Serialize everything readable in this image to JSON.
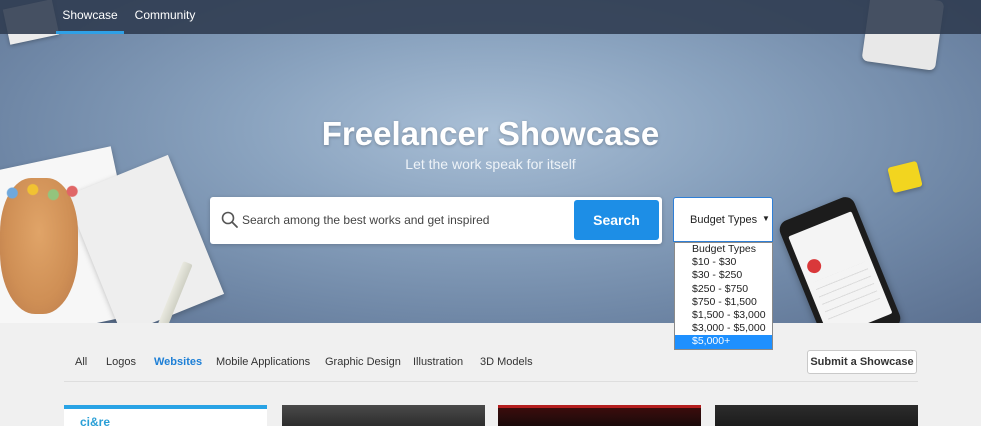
{
  "nav": {
    "items": [
      {
        "label": "Showcase",
        "active": true
      },
      {
        "label": "Community",
        "active": false
      }
    ]
  },
  "hero": {
    "title": "Freelancer Showcase",
    "subtitle": "Let the work speak for itself"
  },
  "search": {
    "placeholder": "Search among the best works and get inspired",
    "button_label": "Search"
  },
  "budget": {
    "selected": "Budget Types",
    "options": [
      "Budget Types",
      "$10 - $30",
      "$30 - $250",
      "$250 - $750",
      "$750 - $1,500",
      "$1,500 - $3,000",
      "$3,000 - $5,000",
      "$5,000+"
    ],
    "highlighted": "$5,000+"
  },
  "categories": {
    "tabs": [
      "All",
      "Logos",
      "Websites",
      "Mobile Applications",
      "Graphic Design",
      "Illustration",
      "3D Models"
    ],
    "active": "Websites",
    "submit_label": "Submit a Showcase"
  },
  "thumbnails": {
    "first_logo": "ci&re"
  },
  "colors": {
    "accent": "#1d8ee6",
    "nav_bg": "#2d3a4e",
    "active_tab": "#1d7fd6",
    "dropdown_highlight": "#1e90ff"
  }
}
